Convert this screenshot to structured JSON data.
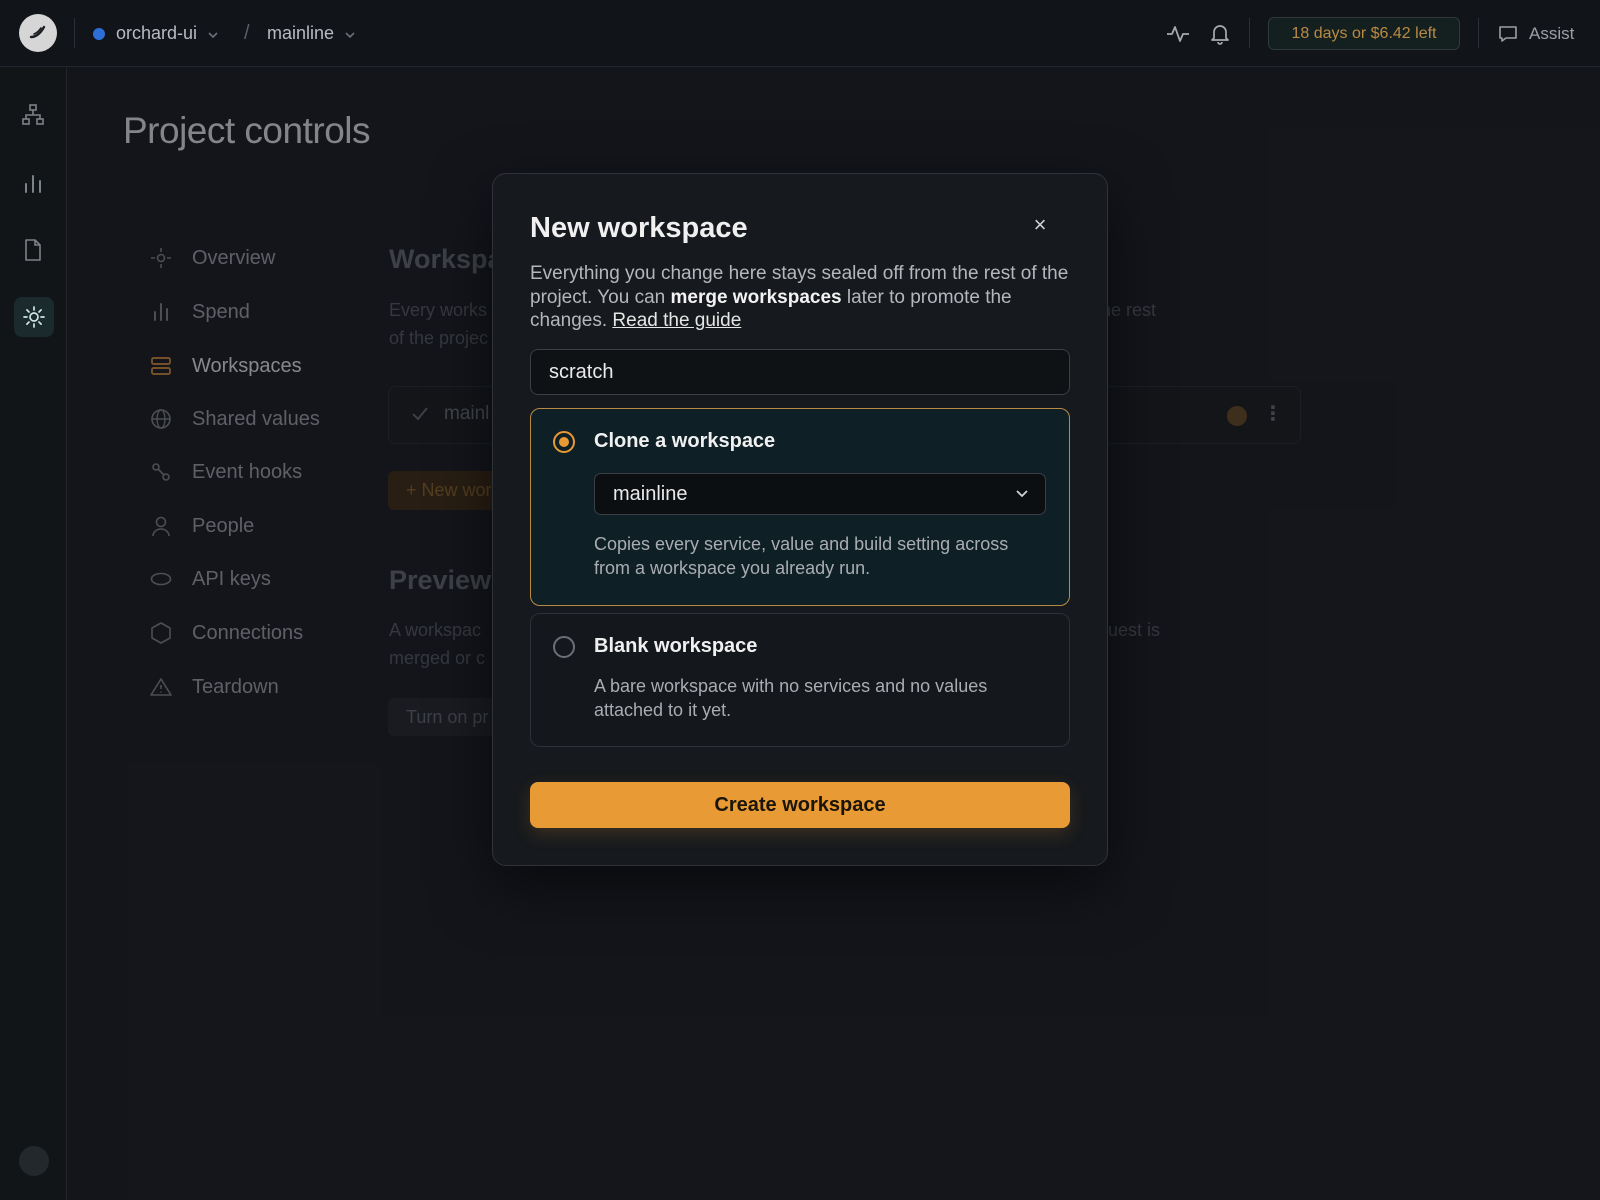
{
  "topbar": {
    "project": "orchard-ui",
    "branch": "mainline",
    "separator": "/",
    "trial": "18 days or $6.42 left",
    "assist": "Assist"
  },
  "rail": {
    "icons": [
      "topology-icon",
      "chart-icon",
      "document-icon",
      "settings-sun-icon"
    ]
  },
  "page": {
    "title": "Project controls",
    "nav": [
      {
        "label": "Overview",
        "icon": "crosshair-icon"
      },
      {
        "label": "Spend",
        "icon": "bar-chart-icon"
      },
      {
        "label": "Workspaces",
        "icon": "server-stack-icon"
      },
      {
        "label": "Shared values",
        "icon": "globe-icon"
      },
      {
        "label": "Event hooks",
        "icon": "webhook-icon"
      },
      {
        "label": "People",
        "icon": "person-icon"
      },
      {
        "label": "API keys",
        "icon": "key-icon"
      },
      {
        "label": "Connections",
        "icon": "hexagon-icon"
      },
      {
        "label": "Teardown",
        "icon": "warning-icon"
      }
    ],
    "bg": {
      "workspaces_heading": "Workspa",
      "workspaces_desc_1": "Every works",
      "workspaces_desc_2": "of the projec",
      "workspaces_desc_right": "ne rest",
      "row_label": "mainl",
      "new_btn": "+ New wor",
      "preview_heading": "Preview",
      "preview_desc_1": "A workspac",
      "preview_desc_2": "merged or c",
      "preview_desc_right": "uest is",
      "turn_on_btn": "Turn on pr"
    }
  },
  "modal": {
    "title": "New workspace",
    "close": "×",
    "desc_pre": "Everything you change here stays sealed off from the rest of the project. You can ",
    "desc_bold": "merge workspaces",
    "desc_post": " later to promote the changes. ",
    "desc_link": "Read the guide",
    "name_value": "scratch",
    "options": {
      "clone": {
        "title": "Clone a workspace",
        "source": "mainline",
        "desc": "Copies every service, value and build setting across from a workspace you already run."
      },
      "blank": {
        "title": "Blank workspace",
        "desc": "A bare workspace with no services and no values attached to it yet."
      }
    },
    "create_label": "Create workspace"
  },
  "colors": {
    "accent": "#e89a35",
    "background": "#1a1d22",
    "modal": "#16191d"
  }
}
